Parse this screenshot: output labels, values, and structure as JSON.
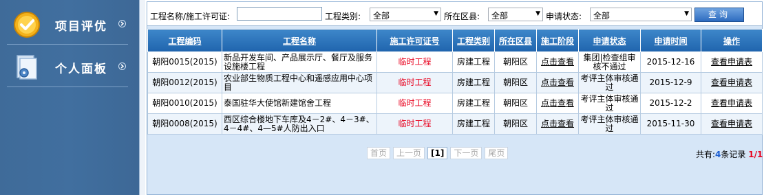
{
  "sidebar": {
    "items": [
      {
        "label": "项目评优",
        "icon": "gold-badge-checkmark-icon"
      },
      {
        "label": "个人面板",
        "icon": "document-gear-icon"
      }
    ]
  },
  "search": {
    "name_label": "工程名称/施工许可证:",
    "name_value": "",
    "type_label": "工程类别:",
    "type_value": "全部",
    "district_label": "所在区县:",
    "district_value": "全部",
    "status_label": "申请状态:",
    "status_value": "全部",
    "query_button": "查询"
  },
  "table": {
    "headers": [
      "工程编码",
      "工程名称",
      "施工许可证号",
      "工程类别",
      "所在区县",
      "施工阶段",
      "申请状态",
      "申请时间",
      "操作"
    ],
    "rows": [
      {
        "code": "朝阳0015(2015)",
        "name": "新品开发车间、产品展示厅、餐厅及服务设施楼工程",
        "permit": "临时工程",
        "type": "房建工程",
        "district": "朝阳区",
        "stage": "点击查看",
        "status": "集团|检查组审核不通过",
        "date": "2015-12-16",
        "action": "查看申请表"
      },
      {
        "code": "朝阳0012(2015)",
        "name": "农业部生物质工程中心和遥感应用中心项目",
        "permit": "临时工程",
        "type": "房建工程",
        "district": "朝阳区",
        "stage": "点击查看",
        "status": "考评主体审核通过",
        "date": "2015-12-9",
        "action": "查看申请表"
      },
      {
        "code": "朝阳0010(2015)",
        "name": "泰国驻华大使馆新建馆舍工程",
        "permit": "临时工程",
        "type": "房建工程",
        "district": "朝阳区",
        "stage": "点击查看",
        "status": "考评主体审核通过",
        "date": "2015-12-2",
        "action": "查看申请表"
      },
      {
        "code": "朝阳0008(2015)",
        "name": "西区综合楼地下车库及4－2#、4－3#、4－4#、4—5#人防出入口",
        "permit": "临时工程",
        "type": "房建工程",
        "district": "朝阳区",
        "stage": "点击查看",
        "status": "考评主体审核通过",
        "date": "2015-11-30",
        "action": "查看申请表"
      }
    ]
  },
  "pager": {
    "first": "首页",
    "prev": "上一页",
    "current": "[1]",
    "next": "下一页",
    "last": "尾页",
    "total_prefix": "共有:",
    "total_count": "4",
    "total_suffix": "条记录",
    "page_info": "1/1"
  },
  "colors": {
    "sidebar_bg": "#416f9f",
    "header_bg": "#2a73bb",
    "accent_red": "#e8001d",
    "count_blue": "#1d5fd1"
  }
}
